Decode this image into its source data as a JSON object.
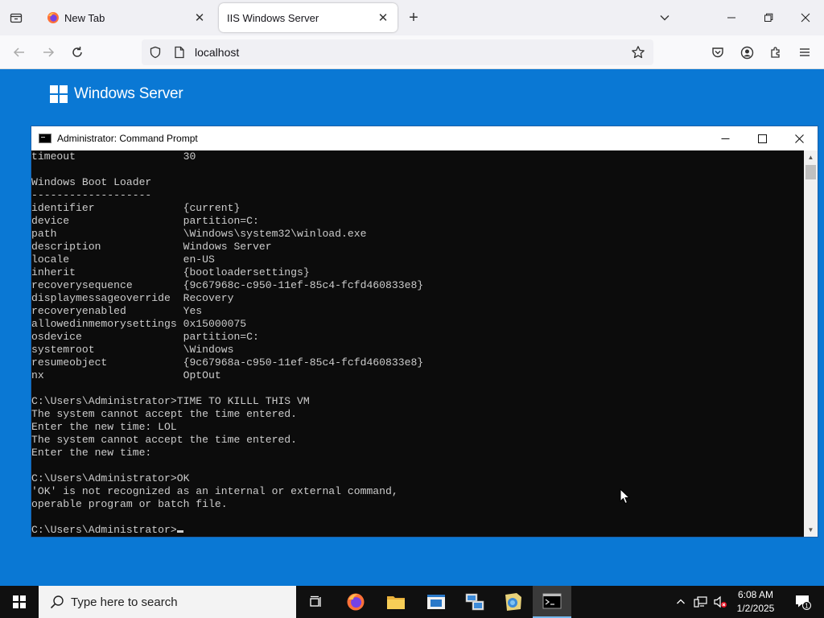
{
  "browser": {
    "tabs": [
      {
        "title": "New Tab",
        "active": false
      },
      {
        "title": "IIS Windows Server",
        "active": true
      }
    ],
    "url": "localhost"
  },
  "page": {
    "logo_text": "Windows Server"
  },
  "cmd": {
    "title": "Administrator: Command Prompt",
    "lines": [
      "timeout                 30",
      "",
      "Windows Boot Loader",
      "-------------------",
      "identifier              {current}",
      "device                  partition=C:",
      "path                    \\Windows\\system32\\winload.exe",
      "description             Windows Server",
      "locale                  en-US",
      "inherit                 {bootloadersettings}",
      "recoverysequence        {9c67968c-c950-11ef-85c4-fcfd460833e8}",
      "displaymessageoverride  Recovery",
      "recoveryenabled         Yes",
      "allowedinmemorysettings 0x15000075",
      "osdevice                partition=C:",
      "systemroot              \\Windows",
      "resumeobject            {9c67968a-c950-11ef-85c4-fcfd460833e8}",
      "nx                      OptOut",
      "",
      "C:\\Users\\Administrator>TIME TO KILLL THIS VM",
      "The system cannot accept the time entered.",
      "Enter the new time: LOL",
      "The system cannot accept the time entered.",
      "Enter the new time:",
      "",
      "C:\\Users\\Administrator>OK",
      "'OK' is not recognized as an internal or external command,",
      "operable program or batch file.",
      ""
    ],
    "prompt": "C:\\Users\\Administrator>"
  },
  "taskbar": {
    "search_placeholder": "Type here to search",
    "apps": [
      "task-view-icon",
      "firefox-icon",
      "file-explorer-icon",
      "server-manager-icon",
      "network-icon",
      "iis-manager-icon",
      "command-prompt-icon"
    ],
    "time": "6:08 AM",
    "date": "1/2/2025",
    "notification_count": "1"
  },
  "colors": {
    "page_background": "#0a78d4",
    "console_background": "#0c0c0c",
    "console_text": "#cccccc",
    "taskbar": "#101010"
  }
}
